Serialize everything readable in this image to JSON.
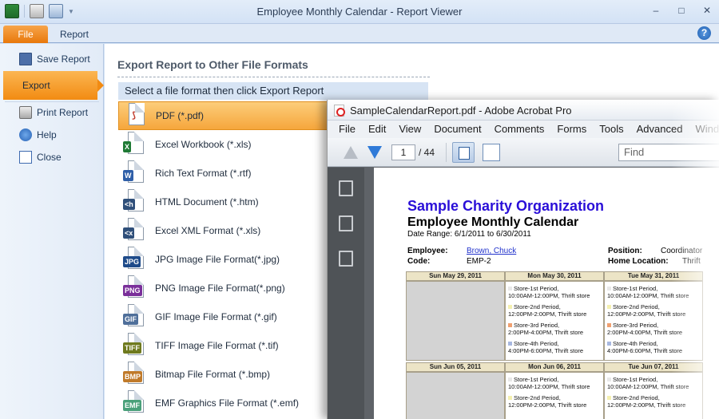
{
  "window": {
    "title": "Employee Monthly Calendar - Report Viewer",
    "controls": {
      "minimize": "–",
      "maximize": "□",
      "close": "✕"
    }
  },
  "tabs": {
    "file": "File",
    "report": "Report"
  },
  "nav": {
    "save": "Save Report",
    "export": "Export",
    "print": "Print Report",
    "help": "Help",
    "close": "Close"
  },
  "main": {
    "title": "Export Report to Other File Formats",
    "subtitle": "Select a file format then click Export Report",
    "formats": [
      {
        "label": "PDF (*.pdf)",
        "badge": "",
        "color": "#c0392b",
        "icon": "pdf-icon"
      },
      {
        "label": "Excel Workbook (*.xls)",
        "badge": "X",
        "color": "#1f7a35",
        "icon": "excel-icon"
      },
      {
        "label": "Rich Text Format (*.rtf)",
        "badge": "W",
        "color": "#2f5fa8",
        "icon": "word-icon"
      },
      {
        "label": "HTML Document (*.htm)",
        "badge": "<h",
        "color": "#2f4f7a",
        "icon": "html-icon"
      },
      {
        "label": "Excel XML Format (*.xls)",
        "badge": "<x",
        "color": "#2f4f7a",
        "icon": "xml-icon"
      },
      {
        "label": "JPG Image File Format(*.jpg)",
        "badge": "JPG",
        "color": "#1e4b8a",
        "icon": "jpg-icon"
      },
      {
        "label": "PNG Image File Format(*.png)",
        "badge": "PNG",
        "color": "#7a2f9a",
        "icon": "png-icon"
      },
      {
        "label": "GIF Image File Format (*.gif)",
        "badge": "GIF",
        "color": "#4f6f9a",
        "icon": "gif-icon"
      },
      {
        "label": "TIFF Image File Format (*.tif)",
        "badge": "TIFF",
        "color": "#6f7a1e",
        "icon": "tiff-icon"
      },
      {
        "label": "Bitmap File Format (*.bmp)",
        "badge": "BMP",
        "color": "#c07a2a",
        "icon": "bmp-icon"
      },
      {
        "label": "EMF Graphics File Format (*.emf)",
        "badge": "EMF",
        "color": "#4aa07a",
        "icon": "emf-icon"
      }
    ],
    "selected_index": 0
  },
  "acrobat": {
    "title": "SampleCalendarReport.pdf - Adobe Acrobat Pro",
    "menu": [
      "File",
      "Edit",
      "View",
      "Document",
      "Comments",
      "Forms",
      "Tools",
      "Advanced",
      "Window"
    ],
    "page_current": "1",
    "page_total": "/ 44",
    "find_placeholder": "Find",
    "document": {
      "org": "Sample Charity Organization",
      "report": "Employee Monthly Calendar",
      "date_range": "Date Range: 6/1/2011 to 6/30/2011",
      "employee_label": "Employee:",
      "employee_value": "Brown, Chuck",
      "code_label": "Code:",
      "code_value": "EMP-2",
      "position_label": "Position:",
      "position_value": "Coordinator",
      "home_label": "Home Location:",
      "home_value": "Thrift",
      "week1": [
        "Sun May 29, 2011",
        "Mon May 30, 2011",
        "Tue May 31, 2011"
      ],
      "week2": [
        "Sun Jun 05, 2011",
        "Mon Jun 06, 2011",
        "Tue Jun 07, 2011"
      ],
      "events": [
        {
          "line1": "Store-1st Period,",
          "line2": "10:00AM-12:00PM, Thrift store",
          "color": "#e8e8e8"
        },
        {
          "line1": "Store-2nd Period,",
          "line2": "12:00PM-2:00PM, Thrift store",
          "color": "#f4f0b0"
        },
        {
          "line1": "Store-3rd Period,",
          "line2": "2:00PM-4:00PM, Thrift store",
          "color": "#f0a070"
        },
        {
          "line1": "Store-4th Period,",
          "line2": "4:00PM-6:00PM, Thrift store",
          "color": "#a8b8e0"
        }
      ],
      "week2_events": [
        {
          "line1": "Store-1st Period,",
          "line2": "10:00AM-12:00PM, Thrift store",
          "color": "#e8e8e8"
        },
        {
          "line1": "Store-2nd Period,",
          "line2": "12:00PM-2:00PM, Thrift store",
          "color": "#f4f0b0"
        }
      ]
    }
  }
}
